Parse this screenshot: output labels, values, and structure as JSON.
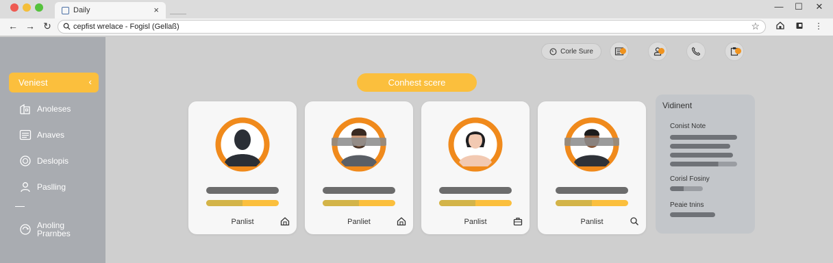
{
  "browser": {
    "tab_title": "Daily",
    "tab_close": "×",
    "address": "cepfist wrelace - Fogisl (Gellaß)",
    "controls": {
      "minimize": "—",
      "maximize": "☐",
      "close": "✕"
    },
    "nav": {
      "back": "←",
      "forward": "→",
      "reload": "↻"
    },
    "bookmark_star": "☆",
    "menu": "⋮"
  },
  "sidebar": {
    "active_label": "Veniest",
    "items": [
      {
        "label": "Anoleses",
        "icon": "building-icon"
      },
      {
        "label": "Anaves",
        "icon": "list-icon"
      },
      {
        "label": "Deslopis",
        "icon": "coin-icon"
      },
      {
        "label": "Paslling",
        "icon": "person-icon"
      },
      {
        "label": "Anoling Prarnbes",
        "icon": "refresh-icon"
      }
    ]
  },
  "header": {
    "score_chip": "Corle Sure"
  },
  "main": {
    "contest_button": "Conhest scere",
    "cards": [
      {
        "label": "Panlist",
        "avatar": "silhouette",
        "progress": 0.5,
        "icon": "home-icon"
      },
      {
        "label": "Panliet",
        "avatar": "man-bearded",
        "progress": 0.5,
        "icon": "home-icon"
      },
      {
        "label": "Panlist",
        "avatar": "woman",
        "progress": 0.5,
        "icon": "briefcase-icon"
      },
      {
        "label": "Panlist",
        "avatar": "man-dark",
        "progress": 0.5,
        "icon": "search-icon"
      }
    ]
  },
  "panel": {
    "title": "Vidinent",
    "sections": [
      {
        "label": "Conist Note"
      },
      {
        "label": "Corisl Fosiny"
      },
      {
        "label": "Peaie tnins"
      }
    ]
  },
  "colors": {
    "accent": "#fbbf3d",
    "orange_ring": "#f08a1c",
    "sidebar": "#a9acb1",
    "badge": "#f0931e"
  }
}
